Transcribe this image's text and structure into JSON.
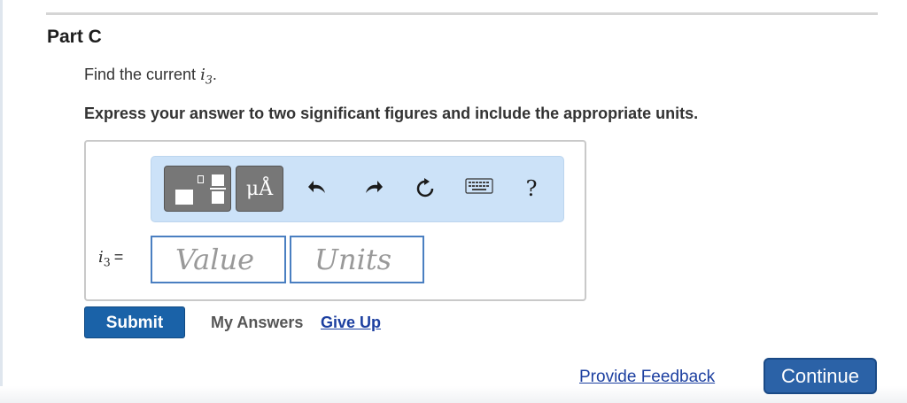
{
  "part": {
    "title": "Part C"
  },
  "question": {
    "prefix": "Find the current ",
    "var": "i",
    "sub": "3",
    "suffix": "."
  },
  "instructions": "Express your answer to two significant figures and include the appropriate units.",
  "toolbar": {
    "units_symbol": "μÅ",
    "help": "?",
    "icons": [
      "templates-icon",
      "units-icon",
      "undo-icon",
      "redo-icon",
      "reset-icon",
      "keyboard-icon",
      "help-icon"
    ]
  },
  "equation": {
    "var": "i",
    "sub": "3",
    "equals": "="
  },
  "fields": {
    "value_placeholder": "Value",
    "units_placeholder": "Units"
  },
  "actions": {
    "submit": "Submit",
    "my_answers": "My Answers",
    "give_up": "Give Up"
  },
  "footer": {
    "feedback": "Provide Feedback",
    "continue": "Continue"
  },
  "colors": {
    "primary": "#1a62a8",
    "toolbar_bg": "#cce2f8",
    "link": "#1c3fa0",
    "field_border": "#4a7fc1"
  }
}
